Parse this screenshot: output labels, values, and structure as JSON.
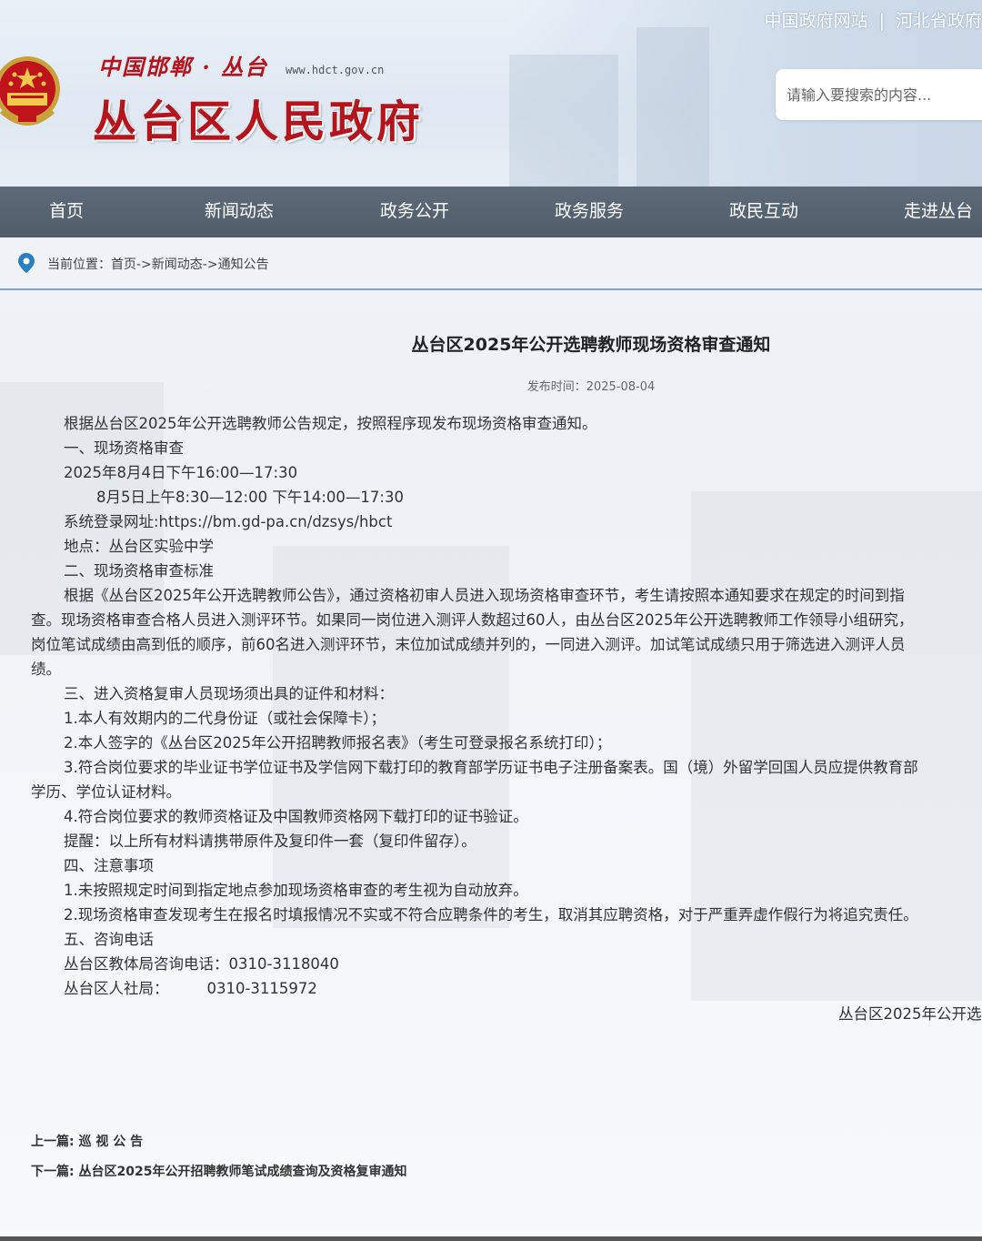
{
  "header": {
    "subtitle": "中国邯郸 · 丛台",
    "domain": "www.hdct.gov.cn",
    "site_title": "丛台区人民政府",
    "toplinks": [
      "中国政府网站",
      "河北省政府"
    ],
    "toplink_sep": "|",
    "search_placeholder": "请输入要搜索的内容..."
  },
  "nav": {
    "items": [
      "首页",
      "新闻动态",
      "政务公开",
      "政务服务",
      "政民互动",
      "走进丛台"
    ]
  },
  "breadcrumb": {
    "label": "当前位置：",
    "path": [
      "首页",
      "->",
      "新闻动态",
      "->",
      "通知公告"
    ]
  },
  "article": {
    "title": "丛台区2025年公开选聘教师现场资格审查通知",
    "pubdate": "发布时间：2025-08-04",
    "lines": [
      "根据丛台区2025年公开选聘教师公告规定，按照程序现发布现场资格审查通知。",
      "一、现场资格审查",
      "2025年8月4日下午16:00—17:30",
      "8月5日上午8:30—12:00 下午14:00—17:30",
      "系统登录网址:https://bm.gd-pa.cn/dzsys/hbct",
      "地点：丛台区实验中学",
      "二、现场资格审查标准",
      "根据《丛台区2025年公开选聘教师公告》，通过资格初审人员进入现场资格审查环节，考生请按照本通知要求在规定的时间到指",
      "查。现场资格审查合格人员进入测评环节。如果同一岗位进入测评人数超过60人，由丛台区2025年公开选聘教师工作领导小组研究，",
      "岗位笔试成绩由高到低的顺序，前60名进入测评环节，末位加试成绩并列的，一同进入测评。加试笔试成绩只用于筛选进入测评人员",
      "绩。",
      "三、进入资格复审人员现场须出具的证件和材料：",
      "1.本人有效期内的二代身份证（或社会保障卡）；",
      "2.本人签字的《丛台区2025年公开招聘教师报名表》（考生可登录报名系统打印）；",
      "3.符合岗位要求的毕业证书学位证书及学信网下载打印的教育部学历证书电子注册备案表。国（境）外留学回国人员应提供教育部",
      "学历、学位认证材料。",
      "4.符合岗位要求的教师资格证及中国教师资格网下载打印的证书验证。",
      "提醒：以上所有材料请携带原件及复印件一套（复印件留存）。",
      "四、注意事项",
      "1.未按照规定时间到指定地点参加现场资格审查的考生视为自动放弃。",
      "2.现场资格审查发现考生在报名时填报情况不实或不符合应聘条件的考生，取消其应聘资格，对于严重弄虚作假行为将追究责任。",
      "五、咨询电话",
      "丛台区教体局咨询电话：0310-3118040",
      "丛台区人社局：        0310-3115972"
    ],
    "signature": "丛台区2025年公开选"
  },
  "prevnext": {
    "prev_label": "上一篇:",
    "prev_title": "巡 视 公 告",
    "next_label": "下一篇:",
    "next_title": "丛台区2025年公开招聘教师笔试成绩查询及资格复审通知"
  },
  "colors": {
    "brand_red": "#b4141b",
    "nav_bg": "#56636f",
    "divider_blue": "#7aa6cc",
    "pin_blue": "#2a7fc0"
  }
}
